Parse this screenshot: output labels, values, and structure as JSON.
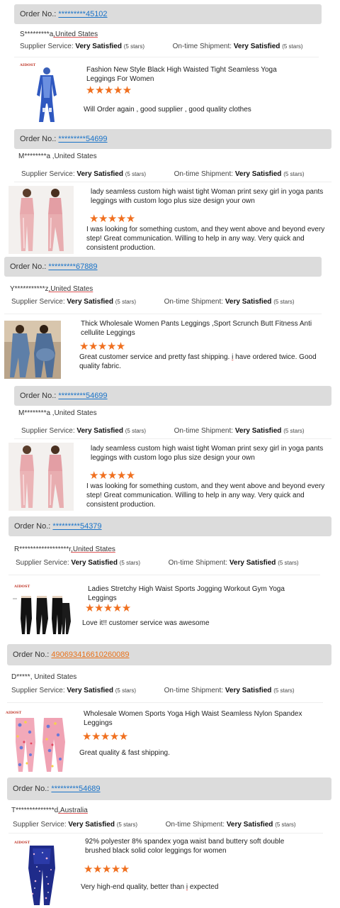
{
  "common": {
    "order_prefix": "Order No.:",
    "supplier_label": "Supplier Service:",
    "shipment_label": "On-time Shipment:",
    "rating_value": "Very Satisfied",
    "rating_stars_text": "(5 stars)",
    "stars": "★★★★★",
    "brand_text": "AIDOST",
    "rating_score": 5,
    "accent_color": "#f07020",
    "link_color": "#1a73c8"
  },
  "reviews": [
    {
      "order_mask": "*********",
      "order_tail": "45102",
      "buyer_name": "S*********a",
      "buyer_country": ",United States",
      "product_title": "Fashion New Style Black High Waisted Tight Seamless Yoga Leggings For Women",
      "review_text": "Will Order again , good supplier , good quality clothes",
      "thumb_icon": "blue-bodysuit-icon"
    },
    {
      "order_mask": "*********",
      "order_tail": "54699",
      "buyer_name": "M********a",
      "buyer_country": " ,United States",
      "product_title": "lady seamless custom high waist tight Woman print sexy girl in yoga pants leggings with custom logo plus size design your own",
      "review_text": "I was looking for something custom, and they went above and beyond every step! Great communication. Willing to help in any way. Very quick and consistent production.",
      "thumb_icon": "pink-leggings-models-icon"
    },
    {
      "order_mask": "*********",
      "order_tail": "67889",
      "buyer_name": "Y***********z",
      "buyer_country": ",United States",
      "product_title": "Thick Wholesale Women Pants Leggings ,Sport Scrunch Butt Fitness Anti cellulite Leggings",
      "review_text_before": "Great customer service and pretty fast shipping. ",
      "review_text_mark": "i",
      "review_text_after": " have ordered twice. Good quality fabric.",
      "thumb_icon": "denim-leggings-models-icon"
    },
    {
      "order_mask": "*********",
      "order_tail": "54699",
      "buyer_name": "M********a",
      "buyer_country": " ,United States",
      "product_title": "lady seamless custom high waist tight Woman print sexy girl in yoga pants leggings with custom logo plus size design your own",
      "review_text": "I was looking for something custom, and they went above and beyond every step! Great communication. Willing to help in any way. Very quick and consistent production.",
      "thumb_icon": "pink-leggings-models-icon"
    },
    {
      "order_mask": "*********",
      "order_tail": "54379",
      "buyer_name": "R******************r",
      "buyer_country": ",United States",
      "product_title": "Ladies Stretchy High Waist Sports Jogging Workout Gym Yoga Leggings",
      "review_text": "Love it!! customer service was awesome",
      "thumb_icon": "black-leggings-icon"
    },
    {
      "order_full": "490693416610260089",
      "buyer_name": "D*****",
      "buyer_country": ", United States",
      "product_title": "Wholesale Women Sports Yoga High Waist Seamless Nylon Spandex Leggings",
      "review_text": "Great quality & fast shipping.",
      "thumb_icon": "floral-leggings-icon"
    },
    {
      "order_mask": "*********",
      "order_tail": "54689",
      "buyer_name": "T**************d",
      "buyer_country": ",Australia",
      "product_title": "92% polyester 8% spandex yoga waist band buttery soft double brushed black solid color leggings for women",
      "review_text_before": "Very high-end quality, better than ",
      "review_text_mark": "i",
      "review_text_after": " expected",
      "thumb_icon": "galaxy-leggings-icon"
    }
  ]
}
